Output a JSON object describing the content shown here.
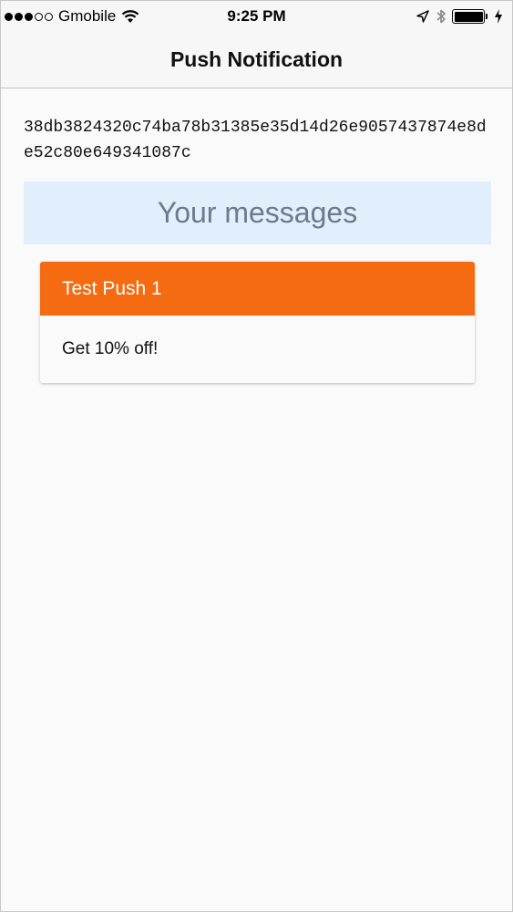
{
  "status_bar": {
    "carrier": "Gmobile",
    "time": "9:25 PM",
    "signal_filled": 3,
    "signal_total": 5
  },
  "nav": {
    "title": "Push Notification"
  },
  "device_token": "38db3824320c74ba78b31385e35d14d26e9057437874e8de52c80e649341087c",
  "messages_section": {
    "heading": "Your messages"
  },
  "messages": [
    {
      "title": "Test Push 1",
      "body": "Get 10% off!"
    }
  ],
  "colors": {
    "card_header": "#f46b12",
    "messages_header_bg": "#e1eefb",
    "messages_header_text": "#6b7b8b"
  }
}
